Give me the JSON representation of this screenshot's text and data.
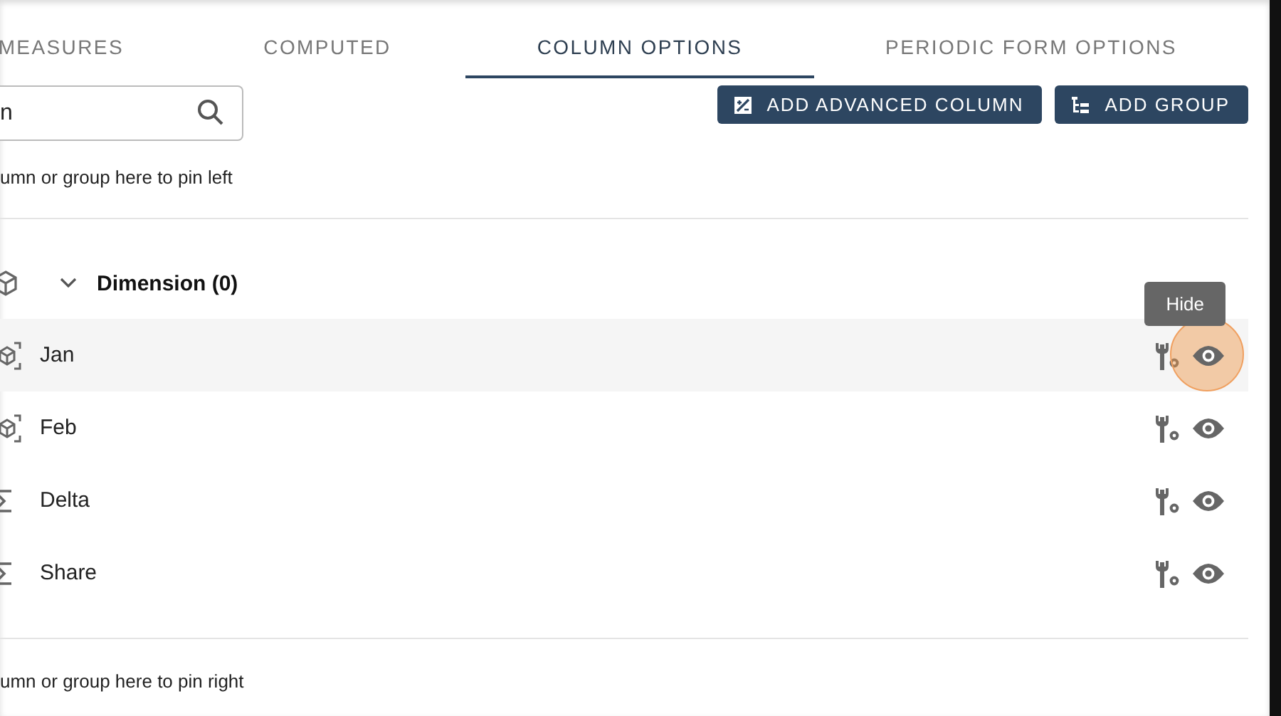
{
  "tabs": [
    {
      "label": "MEASURES",
      "selected": false
    },
    {
      "label": "COMPUTED",
      "selected": false
    },
    {
      "label": "COLUMN OPTIONS",
      "selected": true
    },
    {
      "label": "PERIODIC FORM OPTIONS",
      "selected": false
    }
  ],
  "search": {
    "value": "n"
  },
  "buttons": [
    {
      "label": "ADD ADVANCED COLUMN",
      "kind": "advanced"
    },
    {
      "label": "ADD GROUP",
      "kind": "group"
    }
  ],
  "pin_left_hint": "umn or group here to pin left",
  "group": {
    "title": "Dimension (0)",
    "expanded": true
  },
  "columns": [
    {
      "name": "Jan",
      "kind": "dimension",
      "hovered": true
    },
    {
      "name": "Feb",
      "kind": "dimension",
      "hovered": false
    },
    {
      "name": "Delta",
      "kind": "measure",
      "hovered": false
    },
    {
      "name": "Share",
      "kind": "measure",
      "hovered": false
    }
  ],
  "tooltip": "Hide",
  "pin_right_hint": "umn or group here to pin right"
}
